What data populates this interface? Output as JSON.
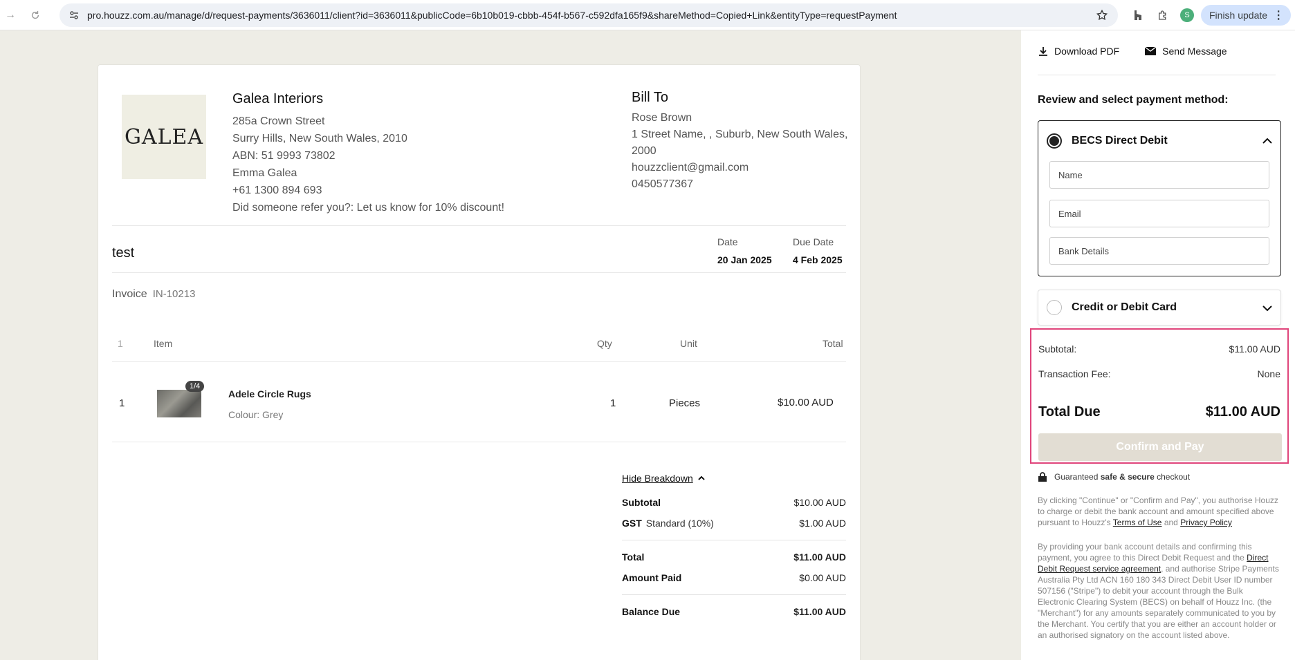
{
  "browser": {
    "url": "pro.houzz.com.au/manage/d/request-payments/3636011/client?id=3636011&publicCode=6b10b019-cbbb-454f-b567-c592dfa165f9&shareMethod=Copied+Link&entityType=requestPayment",
    "profile_initial": "S",
    "finish_update_label": "Finish update"
  },
  "business": {
    "logo_text": "GALEA",
    "name": "Galea Interiors",
    "address1": "285a Crown Street",
    "address2": "Surry Hills, New South Wales, 2010",
    "abn": "ABN: 51 9993 73802",
    "contact": "Emma Galea",
    "phone": "+61 1300 894 693",
    "referral": "Did someone refer you?: Let us know for 10% discount!"
  },
  "bill_to": {
    "title": "Bill To",
    "name": "Rose Brown",
    "address": "1 Street Name, , Suburb, New South Wales, 2000",
    "email": "houzzclient@gmail.com",
    "phone": "0450577367"
  },
  "invoice": {
    "title": "test",
    "date_label": "Date",
    "date_value": "20 Jan 2025",
    "due_label": "Due Date",
    "due_value": "4 Feb 2025",
    "invoice_label": "Invoice",
    "invoice_number": "IN-10213"
  },
  "table": {
    "headers": {
      "index": "1",
      "item": "Item",
      "qty": "Qty",
      "unit": "Unit",
      "total": "Total"
    },
    "rows": [
      {
        "index": "1",
        "image_badge": "1/4",
        "name": "Adele Circle Rugs",
        "description": "Colour: Grey",
        "qty": "1",
        "unit": "Pieces",
        "total": "$10.00 AUD"
      }
    ]
  },
  "breakdown": {
    "toggle_label": "Hide Breakdown",
    "subtotal_label": "Subtotal",
    "subtotal_value": "$10.00 AUD",
    "gst_label": "GST",
    "gst_sub": "Standard (10%)",
    "gst_value": "$1.00 AUD",
    "total_label": "Total",
    "total_value": "$11.00 AUD",
    "paid_label": "Amount Paid",
    "paid_value": "$0.00 AUD",
    "balance_label": "Balance Due",
    "balance_value": "$11.00 AUD"
  },
  "panel": {
    "download_label": "Download PDF",
    "message_label": "Send Message",
    "review_label": "Review and select payment method:",
    "becs_label": "BECS Direct Debit",
    "name_placeholder": "Name",
    "email_placeholder": "Email",
    "bank_placeholder": "Bank Details",
    "card_label": "Credit or Debit Card",
    "subtotal_label": "Subtotal:",
    "subtotal_value": "$11.00 AUD",
    "fee_label": "Transaction Fee:",
    "fee_value": "None",
    "total_label": "Total Due",
    "total_value": "$11.00 AUD",
    "confirm_label": "Confirm and Pay",
    "secure_pre": "Guaranteed ",
    "secure_bold": "safe & secure",
    "secure_post": " checkout",
    "legal1_a": "By clicking \"Continue\" or \"Confirm and Pay\", you authorise Houzz to charge or debit the bank account and amount specified above pursuant to Houzz's ",
    "legal1_terms": "Terms of Use",
    "legal1_and": " and ",
    "legal1_privacy": "Privacy Policy",
    "legal2_a": "By providing your bank account details and confirming this payment, you agree to this Direct Debit Request and the ",
    "legal2_link": "Direct Debit Request service agreement",
    "legal2_b": ", and authorise Stripe Payments Australia Pty Ltd ACN 160 180 343 Direct Debit User ID number 507156 (\"Stripe\") to debit your account through the Bulk Electronic Clearing System (BECS) on behalf of Houzz Inc. (the \"Merchant\") for any amounts separately communicated to you by the Merchant. You certify that you are either an account holder or an authorised signatory on the account listed above."
  },
  "colors": {
    "highlight_border": "#e0457b",
    "confirm_bg": "#e2ddd3",
    "page_bg": "#eeede6"
  }
}
